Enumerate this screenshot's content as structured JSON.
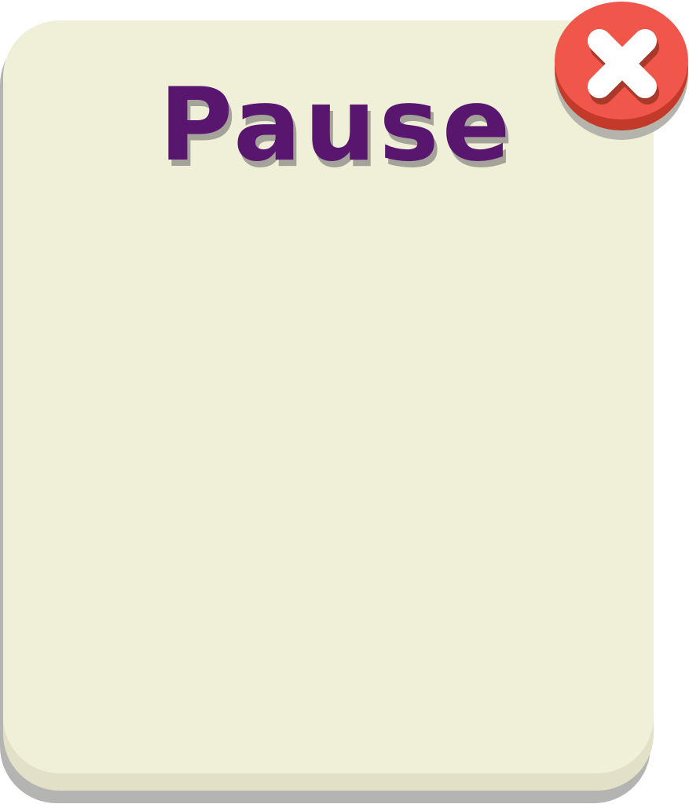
{
  "dialog": {
    "title": "Pause"
  },
  "close_button": {
    "icon": "close-icon"
  },
  "colors": {
    "panel": "#f0efd8",
    "panel_lip": "#e2e0c6",
    "panel_shadow": "#b4b4b2",
    "title": "#58166e",
    "title_shadow": "#a3a39a",
    "close_face": "#f0574a",
    "close_base": "#c43a2a",
    "close_icon": "#ffffff"
  }
}
